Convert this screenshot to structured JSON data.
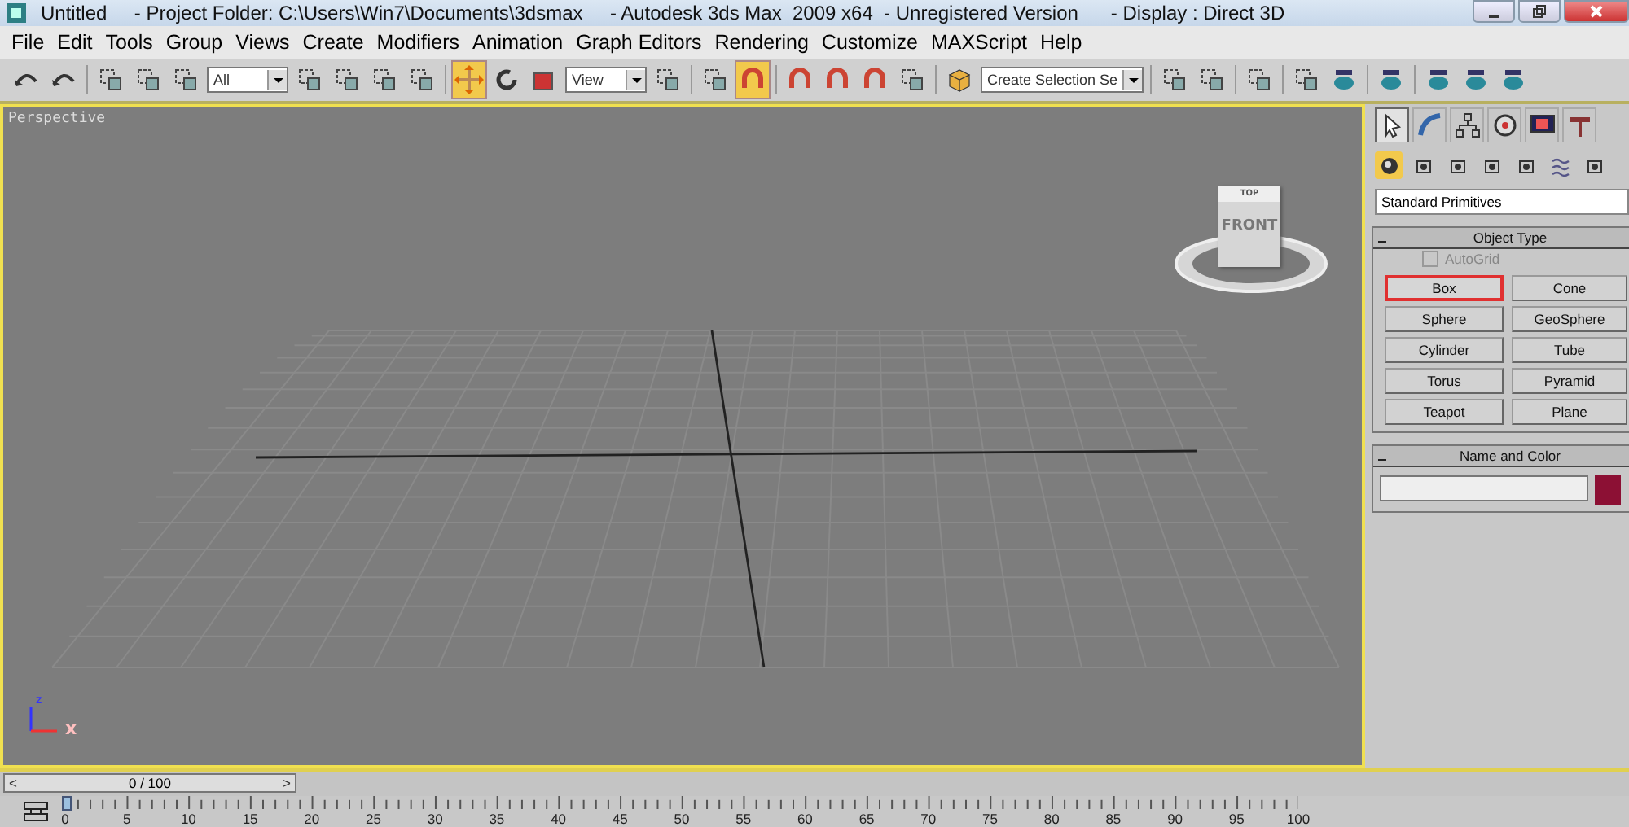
{
  "window": {
    "title": "Untitled     - Project Folder: C:\\Users\\Win7\\Documents\\3dsmax     - Autodesk 3ds Max  2009 x64  - Unregistered Version      - Display : Direct 3D"
  },
  "menu": [
    "File",
    "Edit",
    "Tools",
    "Group",
    "Views",
    "Create",
    "Modifiers",
    "Animation",
    "Graph Editors",
    "Rendering",
    "Customize",
    "MAXScript",
    "Help"
  ],
  "toolbar": [
    {
      "kind": "button",
      "selected": false
    },
    {
      "kind": "button",
      "selected": false
    },
    {
      "kind": "separator"
    },
    {
      "kind": "button",
      "selected": false
    },
    {
      "kind": "button",
      "selected": false
    },
    {
      "kind": "button",
      "selected": false
    },
    {
      "kind": "dropdown",
      "value": "All"
    },
    {
      "kind": "button",
      "selected": false
    },
    {
      "kind": "button",
      "selected": false
    },
    {
      "kind": "button",
      "selected": false
    },
    {
      "kind": "button",
      "selected": false
    },
    {
      "kind": "separator"
    },
    {
      "kind": "button",
      "selected": true
    },
    {
      "kind": "button",
      "selected": false
    },
    {
      "kind": "button",
      "selected": false
    },
    {
      "kind": "dropdown",
      "value": "View"
    },
    {
      "kind": "button",
      "selected": false
    },
    {
      "kind": "separator"
    },
    {
      "kind": "button",
      "selected": false
    },
    {
      "kind": "button",
      "selected": true
    },
    {
      "kind": "separator"
    },
    {
      "kind": "button",
      "selected": false
    },
    {
      "kind": "button",
      "selected": false
    },
    {
      "kind": "button",
      "selected": false
    },
    {
      "kind": "button",
      "selected": false
    },
    {
      "kind": "separator"
    },
    {
      "kind": "button",
      "selected": false
    },
    {
      "kind": "dropdown",
      "value": "Create Selection Se"
    },
    {
      "kind": "separator"
    },
    {
      "kind": "button",
      "selected": false
    },
    {
      "kind": "button",
      "selected": false
    },
    {
      "kind": "separator"
    },
    {
      "kind": "button",
      "selected": false
    },
    {
      "kind": "separator"
    },
    {
      "kind": "button",
      "selected": false
    },
    {
      "kind": "button",
      "selected": false
    },
    {
      "kind": "separator"
    },
    {
      "kind": "button",
      "selected": false
    },
    {
      "kind": "separator"
    },
    {
      "kind": "button",
      "selected": false
    },
    {
      "kind": "button",
      "selected": false
    },
    {
      "kind": "button",
      "selected": false
    }
  ],
  "viewport": {
    "label": "Perspective",
    "active": true,
    "viewcube": {
      "top": "TOP",
      "front": "FRONT"
    },
    "tripod": {
      "z": "z",
      "x": "x"
    }
  },
  "command_panel": {
    "tabs": [
      {
        "selected": true
      },
      {
        "selected": false
      },
      {
        "selected": false
      },
      {
        "selected": false
      },
      {
        "selected": false
      },
      {
        "selected": false
      }
    ],
    "categories": [
      {
        "selected": true
      },
      {
        "selected": false
      },
      {
        "selected": false
      },
      {
        "selected": false
      },
      {
        "selected": false
      },
      {
        "selected": false
      },
      {
        "selected": false
      }
    ],
    "dropdown": "Standard Primitives",
    "object_type": {
      "title": "Object Type",
      "autogrid": {
        "label": "AutoGrid",
        "checked": false,
        "disabled": true
      },
      "buttons": [
        {
          "label": "Box",
          "selected": true
        },
        {
          "label": "Cone",
          "selected": false
        },
        {
          "label": "Sphere",
          "selected": false
        },
        {
          "label": "GeoSphere",
          "selected": false
        },
        {
          "label": "Cylinder",
          "selected": false
        },
        {
          "label": "Tube",
          "selected": false
        },
        {
          "label": "Torus",
          "selected": false
        },
        {
          "label": "Pyramid",
          "selected": false
        },
        {
          "label": "Teapot",
          "selected": false
        },
        {
          "label": "Plane",
          "selected": false
        }
      ]
    },
    "name_and_color": {
      "title": "Name and Color",
      "color": "#8c1034"
    }
  },
  "timeline": {
    "prev": "<",
    "position": "0 / 100",
    "next": ">",
    "level": 0.0
  },
  "ruler": {
    "labels": [
      "0",
      "5",
      "10",
      "15",
      "20",
      "25",
      "30",
      "35",
      "40",
      "45",
      "50",
      "55",
      "60",
      "65",
      "70",
      "75",
      "80",
      "85",
      "90",
      "95",
      "100"
    ]
  }
}
